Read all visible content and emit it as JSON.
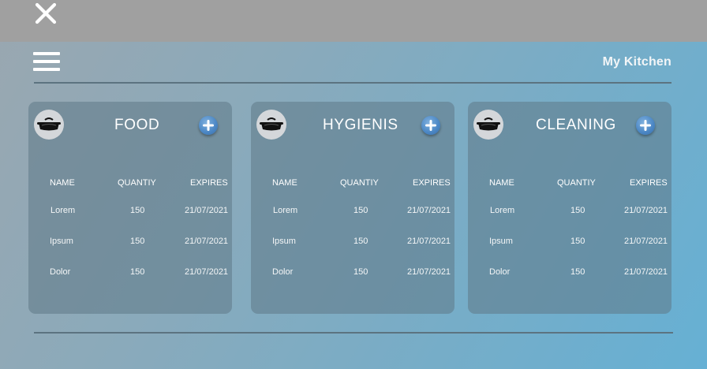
{
  "window": {
    "close_icon": "close-icon"
  },
  "header": {
    "menu_icon": "hamburger-menu-icon",
    "title": "My Kitchen"
  },
  "columns": {
    "name": "NAME",
    "quantity": "QUANTIY",
    "expires": "EXPIRES"
  },
  "categories": [
    {
      "title": "FOOD",
      "icon": "pot-icon",
      "add_icon": "plus-icon",
      "rows": [
        {
          "name": "Lorem",
          "quantity": "150",
          "expires": "21/07/2021"
        },
        {
          "name": "Ipsum",
          "quantity": "150",
          "expires": "21/07/2021"
        },
        {
          "name": "Dolor",
          "quantity": "150",
          "expires": "21/07/2021"
        }
      ]
    },
    {
      "title": "HYGIENIS",
      "icon": "pot-icon",
      "add_icon": "plus-icon",
      "rows": [
        {
          "name": "Lorem",
          "quantity": "150",
          "expires": "21/07/2021"
        },
        {
          "name": "Ipsum",
          "quantity": "150",
          "expires": "21/07/2021"
        },
        {
          "name": "Dolor",
          "quantity": "150",
          "expires": "21/07/2021"
        }
      ]
    },
    {
      "title": "CLEANING",
      "icon": "pot-icon",
      "add_icon": "plus-icon",
      "rows": [
        {
          "name": "Lorem",
          "quantity": "150",
          "expires": "21/07/2021"
        },
        {
          "name": "Ipsum",
          "quantity": "150",
          "expires": "21/07/2021"
        },
        {
          "name": "Dolor",
          "quantity": "150",
          "expires": "21/07/2021"
        }
      ]
    }
  ],
  "colors": {
    "topbar": "#a0a0a0",
    "accent_add": "#4a86c4",
    "card_bg": "#5f7887",
    "divider": "#5c7380"
  }
}
